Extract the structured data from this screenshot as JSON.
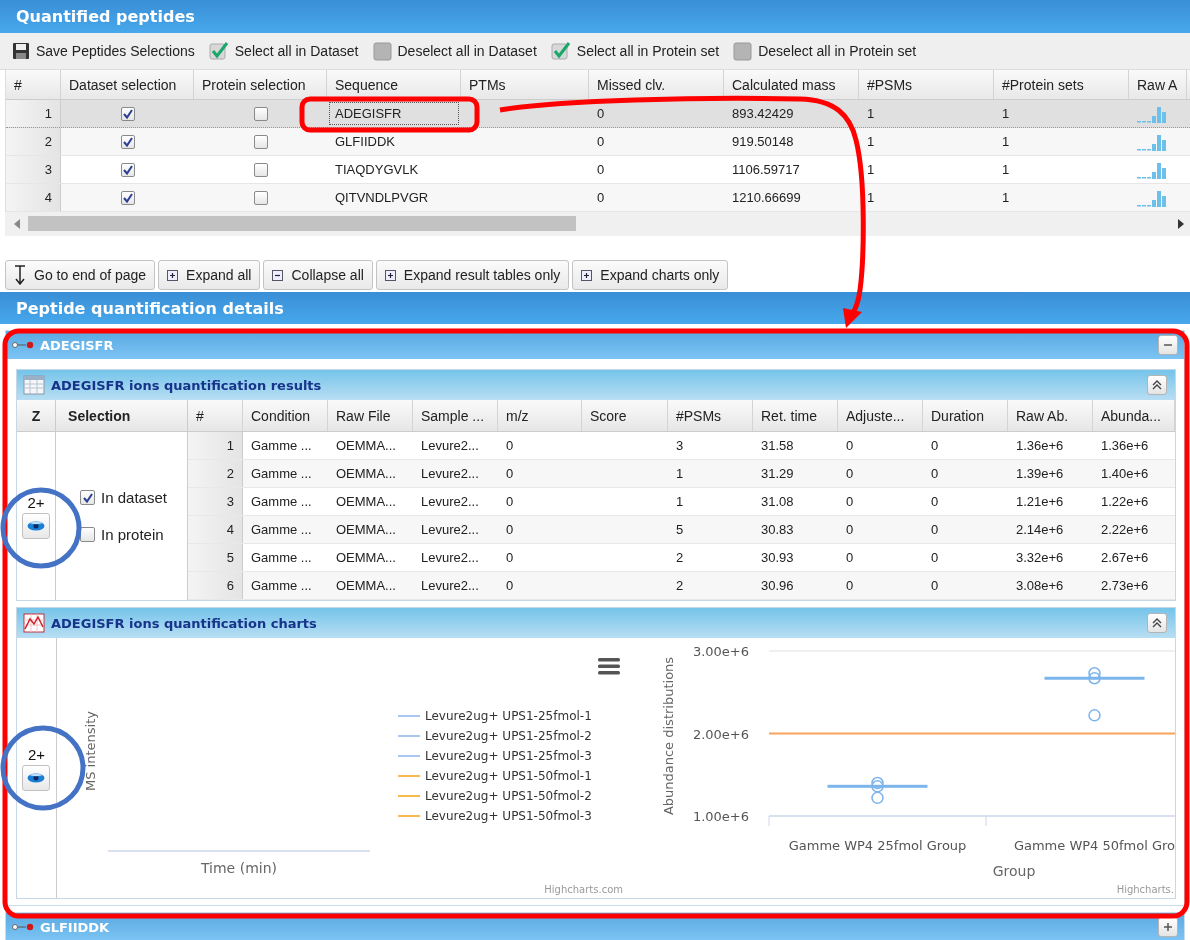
{
  "title": "Quantified peptides",
  "toolbar": [
    {
      "kind": "save",
      "label": "Save Peptides Selections"
    },
    {
      "kind": "select",
      "label": "Select all in Dataset"
    },
    {
      "kind": "deselect",
      "label": "Deselect all in Dataset"
    },
    {
      "kind": "select",
      "label": "Select all in Protein set"
    },
    {
      "kind": "deselect",
      "label": "Deselect all in Protein set"
    }
  ],
  "peptides_table": {
    "columns": [
      "#",
      "Dataset selection",
      "Protein selection",
      "Sequence",
      "PTMs",
      "Missed clv.",
      "Calculated mass",
      "#PSMs",
      "#Protein sets",
      "Raw A"
    ],
    "rows": [
      {
        "index": "1",
        "dataset_selected": true,
        "protein_selected": false,
        "sequence": "ADEGISFR",
        "missed_clv": "0",
        "mass": "893.42429",
        "psms": "1",
        "protein_sets": "1",
        "selected": true
      },
      {
        "index": "2",
        "dataset_selected": true,
        "protein_selected": false,
        "sequence": "GLFIIDDK",
        "missed_clv": "0",
        "mass": "919.50148",
        "psms": "1",
        "protein_sets": "1",
        "selected": false
      },
      {
        "index": "3",
        "dataset_selected": true,
        "protein_selected": false,
        "sequence": "TIAQDYGVLK",
        "missed_clv": "0",
        "mass": "1106.59717",
        "psms": "1",
        "protein_sets": "1",
        "selected": false
      },
      {
        "index": "4",
        "dataset_selected": true,
        "protein_selected": false,
        "sequence": "QITVNDLPVGR",
        "missed_clv": "0",
        "mass": "1210.66699",
        "psms": "1",
        "protein_sets": "1",
        "selected": false
      }
    ]
  },
  "nav_buttons": [
    {
      "kind": "end",
      "label": "Go to end of page"
    },
    {
      "kind": "expand",
      "label": "Expand all"
    },
    {
      "kind": "collapse",
      "label": "Collapse all"
    },
    {
      "kind": "expand",
      "label": "Expand result tables only"
    },
    {
      "kind": "expand",
      "label": "Expand charts only"
    }
  ],
  "details_title": "Peptide quantification details",
  "peptide_panels": [
    {
      "name": "ADEGISFR",
      "expanded": true,
      "results": {
        "title": "ADEGISFR ions quantification results",
        "expanded": true,
        "charge": "2+",
        "in_dataset": {
          "label": "In dataset",
          "checked": true
        },
        "in_protein": {
          "label": "In protein",
          "checked": false
        },
        "columns": [
          "Z",
          "Selection",
          "#",
          "Condition",
          "Raw File",
          "Sample ...",
          "m/z",
          "Score",
          "#PSMs",
          "Ret. time",
          "Adjuste...",
          "Duration",
          "Raw Ab.",
          "Abunda..."
        ],
        "rows": [
          {
            "index": "1",
            "condition": "Gamme ...",
            "raw_file": "OEMMA...",
            "sample": "Levure2...",
            "mz": "0",
            "psms": "3",
            "ret_time": "31.58",
            "adjusted": "0",
            "duration": "0",
            "raw_ab": "1.36e+6",
            "abundance": "1.36e+6"
          },
          {
            "index": "2",
            "condition": "Gamme ...",
            "raw_file": "OEMMA...",
            "sample": "Levure2...",
            "mz": "0",
            "psms": "1",
            "ret_time": "31.29",
            "adjusted": "0",
            "duration": "0",
            "raw_ab": "1.39e+6",
            "abundance": "1.40e+6"
          },
          {
            "index": "3",
            "condition": "Gamme ...",
            "raw_file": "OEMMA...",
            "sample": "Levure2...",
            "mz": "0",
            "psms": "1",
            "ret_time": "31.08",
            "adjusted": "0",
            "duration": "0",
            "raw_ab": "1.21e+6",
            "abundance": "1.22e+6"
          },
          {
            "index": "4",
            "condition": "Gamme ...",
            "raw_file": "OEMMA...",
            "sample": "Levure2...",
            "mz": "0",
            "psms": "5",
            "ret_time": "30.83",
            "adjusted": "0",
            "duration": "0",
            "raw_ab": "2.14e+6",
            "abundance": "2.22e+6"
          },
          {
            "index": "5",
            "condition": "Gamme ...",
            "raw_file": "OEMMA...",
            "sample": "Levure2...",
            "mz": "0",
            "psms": "2",
            "ret_time": "30.93",
            "adjusted": "0",
            "duration": "0",
            "raw_ab": "3.32e+6",
            "abundance": "2.67e+6"
          },
          {
            "index": "6",
            "condition": "Gamme ...",
            "raw_file": "OEMMA...",
            "sample": "Levure2...",
            "mz": "0",
            "psms": "2",
            "ret_time": "30.96",
            "adjusted": "0",
            "duration": "0",
            "raw_ab": "3.08e+6",
            "abundance": "2.73e+6"
          }
        ]
      },
      "charts": {
        "title": "ADEGISFR ions quantification charts",
        "expanded": true,
        "charge": "2+",
        "ms_chart": {
          "ylabel": "MS intensity",
          "xlabel": "Time (min)",
          "credit": "Highcharts.com",
          "legend": [
            {
              "label": "Levure2ug+ UPS1-25fmol-1",
              "color": "#a9c8ef"
            },
            {
              "label": "Levure2ug+ UPS1-25fmol-2",
              "color": "#a9c8ef"
            },
            {
              "label": "Levure2ug+ UPS1-25fmol-3",
              "color": "#a9c8ef"
            },
            {
              "label": "Levure2ug+ UPS1-50fmol-1",
              "color": "#f8bb4e"
            },
            {
              "label": "Levure2ug+ UPS1-50fmol-2",
              "color": "#f8bb4e"
            },
            {
              "label": "Levure2ug+ UPS1-50fmol-3",
              "color": "#f8bb4e"
            }
          ]
        },
        "chart_data": {
          "type": "scatter",
          "ylabel": "Abundance distributions",
          "xlabel": "Group",
          "categories": [
            "Gamme WP4 25fmol Group",
            "Gamme WP4 50fmol Gro"
          ],
          "series": [
            {
              "color": "#7cb5ec",
              "values": [
                1360000,
                2220000
              ]
            },
            {
              "color": "#7cb5ec",
              "values": [
                1400000,
                2670000
              ]
            },
            {
              "color": "#7cb5ec",
              "values": [
                1220000,
                2730000
              ]
            }
          ],
          "ylim": [
            1000000,
            3000000
          ],
          "yticks": [
            {
              "value": 1000000,
              "label": "1.00e+6"
            },
            {
              "value": 2000000,
              "label": "2.00e+6"
            },
            {
              "value": 3000000,
              "label": "3.00e+6"
            }
          ],
          "ref_lines": [
            {
              "axis": "y",
              "value": 2000000,
              "color": "#f7a35c"
            }
          ]
        },
        "credit": "Highcharts."
      }
    },
    {
      "name": "GLFIIDDK",
      "expanded": false
    }
  ]
}
